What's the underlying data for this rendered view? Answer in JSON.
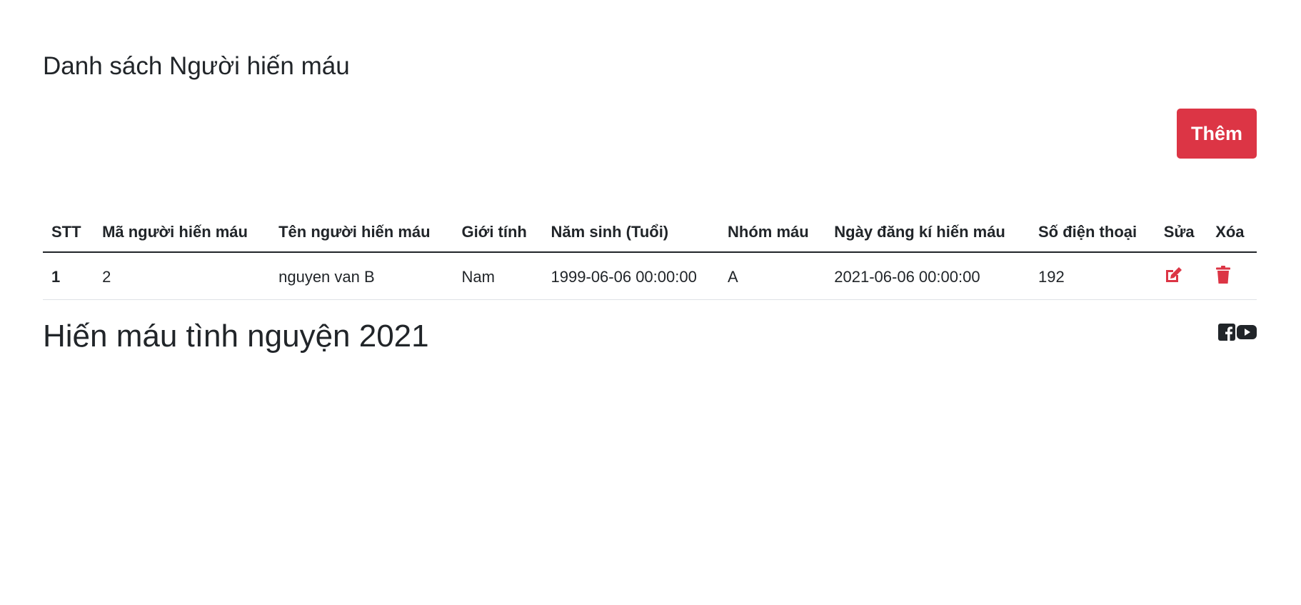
{
  "page": {
    "title": "Danh sách Người hiến máu"
  },
  "toolbar": {
    "add_label": "Thêm"
  },
  "table": {
    "headers": [
      "STT",
      "Mã người hiến máu",
      "Tên người hiến máu",
      "Giới tính",
      "Năm sinh (Tuổi)",
      "Nhóm máu",
      "Ngày đăng kí hiến máu",
      "Số điện thoại",
      "Sửa",
      "Xóa"
    ],
    "rows": [
      {
        "stt": "1",
        "ma": "2",
        "ten": "nguyen van B",
        "gioi_tinh": "Nam",
        "nam_sinh": "1999-06-06 00:00:00",
        "nhom_mau": "A",
        "ngay_dang_ki": "2021-06-06 00:00:00",
        "so_dien_thoai": "192",
        "edit_icon": "edit-icon",
        "delete_icon": "trash-icon"
      }
    ]
  },
  "footer": {
    "title": "Hiến máu tình nguyện 2021",
    "social_icons": [
      "facebook-icon",
      "youtube-icon"
    ]
  },
  "colors": {
    "accent": "#dc3545",
    "text": "#212529",
    "divider": "#dee2e6"
  }
}
